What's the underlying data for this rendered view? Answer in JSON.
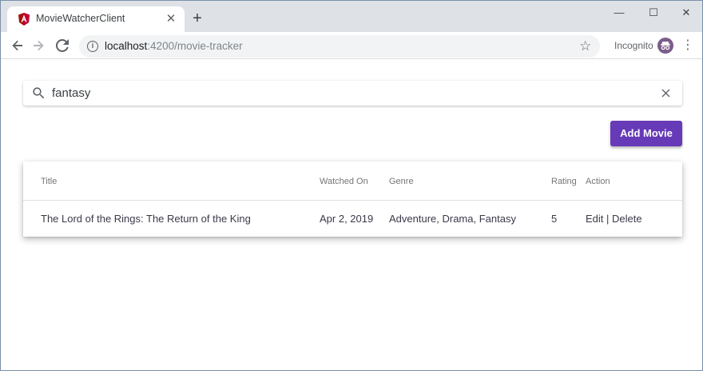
{
  "browser": {
    "tab_title": "MovieWatcherClient",
    "tab_close": "✕",
    "new_tab": "+",
    "url_host": "localhost",
    "url_path": ":4200/movie-tracker",
    "incognito_label": "Incognito",
    "window_controls": {
      "minimize": "—",
      "maximize": "☐",
      "close": "✕"
    }
  },
  "search": {
    "value": "fantasy",
    "icon": "search-icon",
    "clear_icon": "close-icon"
  },
  "toolbar": {
    "add_label": "Add Movie"
  },
  "table": {
    "headers": {
      "title": "Title",
      "watched_on": "Watched On",
      "genre": "Genre",
      "rating": "Rating",
      "action": "Action"
    },
    "rows": [
      {
        "title": "The Lord of the Rings: The Return of the King",
        "watched_on": "Apr 2, 2019",
        "genre": "Adventure, Drama, Fantasy",
        "rating": "5",
        "edit": "Edit",
        "separator": "|",
        "delete": "Delete"
      }
    ]
  },
  "colors": {
    "accent": "#673ab7",
    "tabstrip": "#dee1e6",
    "text": "#3a3a4a"
  }
}
